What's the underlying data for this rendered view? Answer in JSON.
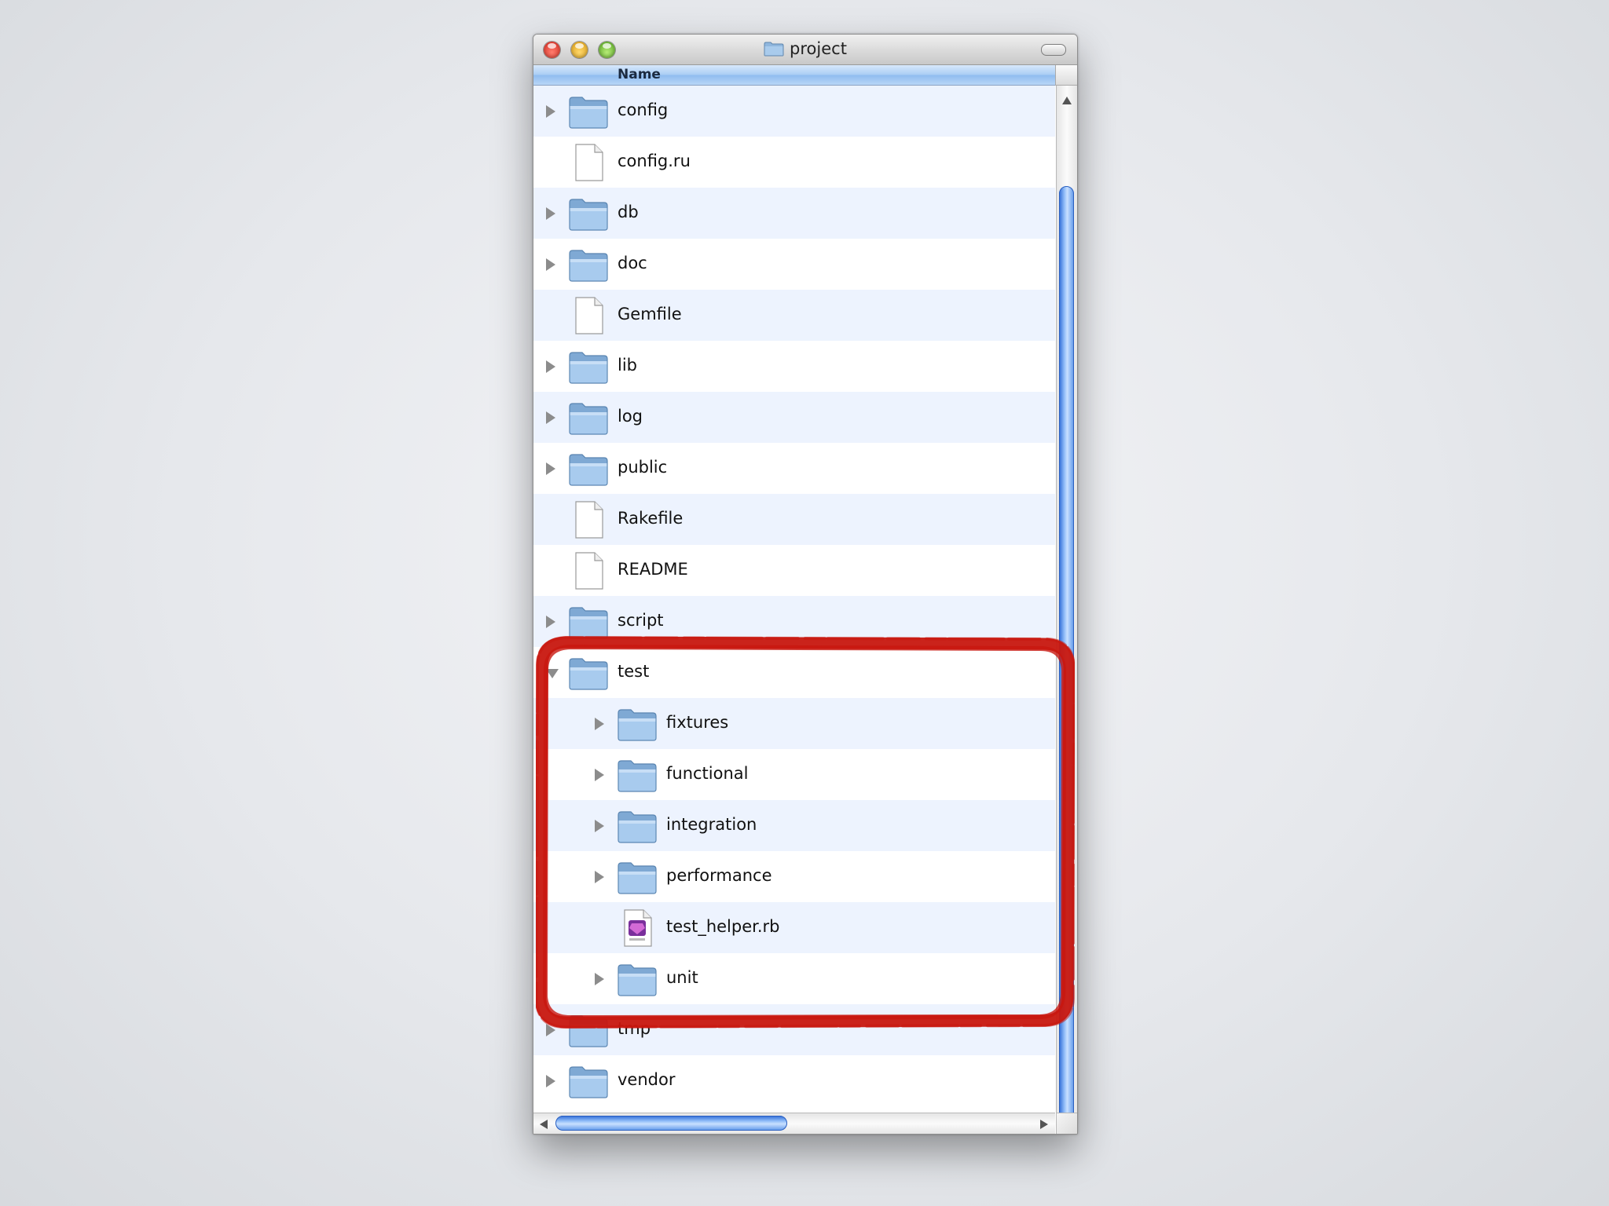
{
  "window": {
    "title": "project"
  },
  "columns": {
    "name_header": "Name"
  },
  "files": [
    {
      "name": "config",
      "kind": "folder",
      "depth": 0,
      "expanded": false
    },
    {
      "name": "config.ru",
      "kind": "file",
      "depth": 0
    },
    {
      "name": "db",
      "kind": "folder",
      "depth": 0,
      "expanded": false
    },
    {
      "name": "doc",
      "kind": "folder",
      "depth": 0,
      "expanded": false
    },
    {
      "name": "Gemfile",
      "kind": "file",
      "depth": 0
    },
    {
      "name": "lib",
      "kind": "folder",
      "depth": 0,
      "expanded": false
    },
    {
      "name": "log",
      "kind": "folder",
      "depth": 0,
      "expanded": false
    },
    {
      "name": "public",
      "kind": "folder",
      "depth": 0,
      "expanded": false
    },
    {
      "name": "Rakefile",
      "kind": "file",
      "depth": 0
    },
    {
      "name": "README",
      "kind": "file",
      "depth": 0
    },
    {
      "name": "script",
      "kind": "folder",
      "depth": 0,
      "expanded": false
    },
    {
      "name": "test",
      "kind": "folder",
      "depth": 0,
      "expanded": true
    },
    {
      "name": "fixtures",
      "kind": "folder",
      "depth": 1,
      "expanded": false
    },
    {
      "name": "functional",
      "kind": "folder",
      "depth": 1,
      "expanded": false
    },
    {
      "name": "integration",
      "kind": "folder",
      "depth": 1,
      "expanded": false
    },
    {
      "name": "performance",
      "kind": "folder",
      "depth": 1,
      "expanded": false
    },
    {
      "name": "test_helper.rb",
      "kind": "ruby",
      "depth": 1
    },
    {
      "name": "unit",
      "kind": "folder",
      "depth": 1,
      "expanded": false
    },
    {
      "name": "tmp",
      "kind": "folder",
      "depth": 0,
      "expanded": false
    },
    {
      "name": "vendor",
      "kind": "folder",
      "depth": 0,
      "expanded": false
    }
  ],
  "colors": {
    "highlight": "#c8170f",
    "folder": "#8fb6dd",
    "row_alt": "#edf3fe"
  }
}
